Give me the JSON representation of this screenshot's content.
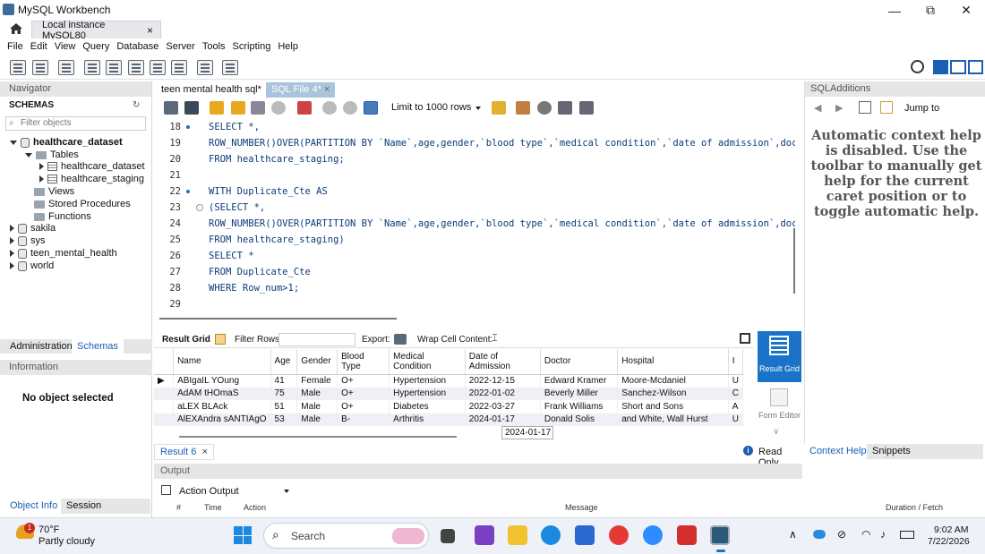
{
  "window": {
    "title": "MySQL Workbench",
    "minimize": "—",
    "maximize": "⧉",
    "close": "✕"
  },
  "connection_tab": {
    "label": "Local instance MySQL80",
    "close": "×"
  },
  "menu": [
    "File",
    "Edit",
    "View",
    "Query",
    "Database",
    "Server",
    "Tools",
    "Scripting",
    "Help"
  ],
  "navigator": {
    "title": "Navigator",
    "schemas_label": "SCHEMAS",
    "filter_placeholder": "Filter objects",
    "tree": {
      "db": "healthcare_dataset",
      "tables": "Tables",
      "table1": "healthcare_dataset",
      "table2": "healthcare_staging",
      "views": "Views",
      "procs": "Stored Procedures",
      "funcs": "Functions",
      "others": [
        "sakila",
        "sys",
        "teen_mental_health",
        "world"
      ]
    },
    "tab_admin": "Administration",
    "tab_schemas": "Schemas",
    "info_title": "Information",
    "no_object": "No object selected",
    "tab_objinfo": "Object Info",
    "tab_session": "Session"
  },
  "editor": {
    "tab1": "teen mental health sql*",
    "tab2": "SQL File 4*",
    "tab2_close": "×",
    "limit": "Limit to 1000 rows",
    "lines": [
      {
        "n": "18",
        "dot": true,
        "fold": false,
        "text": "SELECT *,"
      },
      {
        "n": "19",
        "dot": false,
        "fold": false,
        "text": "ROW_NUMBER()OVER(PARTITION BY `Name`,age,gender,`blood type`,`medical condition`,`date of admission`,doctor,"
      },
      {
        "n": "20",
        "dot": false,
        "fold": false,
        "text": "FROM healthcare_staging;"
      },
      {
        "n": "21",
        "dot": false,
        "fold": false,
        "text": ""
      },
      {
        "n": "22",
        "dot": true,
        "fold": false,
        "text": "WITH Duplicate_Cte AS"
      },
      {
        "n": "23",
        "dot": false,
        "fold": true,
        "text": "(SELECT *,"
      },
      {
        "n": "24",
        "dot": false,
        "fold": false,
        "text": "ROW_NUMBER()OVER(PARTITION BY `Name`,age,gender,`blood type`,`medical condition`,`date of admission`,doctor,"
      },
      {
        "n": "25",
        "dot": false,
        "fold": false,
        "text": "FROM healthcare_staging)"
      },
      {
        "n": "26",
        "dot": false,
        "fold": false,
        "text": "SELECT *"
      },
      {
        "n": "27",
        "dot": false,
        "fold": false,
        "text": "FROM Duplicate_Cte"
      },
      {
        "n": "28",
        "dot": false,
        "fold": false,
        "text": "WHERE Row_num>1;"
      },
      {
        "n": "29",
        "dot": false,
        "fold": false,
        "text": ""
      }
    ]
  },
  "result_toolbar": {
    "result_grid": "Result Grid",
    "filter_rows": "Filter Rows:",
    "export": "Export:",
    "wrap": "Wrap Cell Content:"
  },
  "grid": {
    "headers": [
      "Name",
      "Age",
      "Gender",
      "Blood Type",
      "Medical Condition",
      "Date of Admission",
      "Doctor",
      "Hospital",
      "I"
    ],
    "rows": [
      [
        "ABIgaIL YOung",
        "41",
        "Female",
        "O+",
        "Hypertension",
        "2022-12-15",
        "Edward Kramer",
        "Moore-Mcdaniel",
        "U"
      ],
      [
        "AdAM tHOmaS",
        "75",
        "Male",
        "O+",
        "Hypertension",
        "2022-01-02",
        "Beverly Miller",
        "Sanchez-Wilson",
        "C"
      ],
      [
        "aLEX BLAck",
        "51",
        "Male",
        "O+",
        "Diabetes",
        "2022-03-27",
        "Frank Williams",
        "Short and Sons",
        "A"
      ],
      [
        "AlEXAndra sANTIAgO",
        "53",
        "Male",
        "B-",
        "Arthritis",
        "2024-01-17",
        "Donald Solis",
        "and White, Wall Hurst",
        "U"
      ]
    ],
    "tooltip": "2024-01-17"
  },
  "side_buttons": {
    "result_grid": "Result Grid",
    "form_editor": "Form Editor"
  },
  "result_tab": {
    "label": "Result 6",
    "close": "×",
    "read_only": "Read Only"
  },
  "output": {
    "title": "Output",
    "selector": "Action Output",
    "cols": [
      "#",
      "Time",
      "Action",
      "Message",
      "Duration / Fetch"
    ]
  },
  "sqladditions": {
    "title": "SQLAdditions",
    "jump_to": "Jump to",
    "help_text": "Automatic context help is disabled. Use the toolbar to manually get help for the current caret position or to toggle automatic help.",
    "tab_context": "Context Help",
    "tab_snippets": "Snippets"
  },
  "taskbar": {
    "temp": "70°F",
    "weather": "Partly cloudy",
    "badge": "1",
    "search": "Search",
    "time": "9:02 AM",
    "date": "7/22/2026"
  }
}
